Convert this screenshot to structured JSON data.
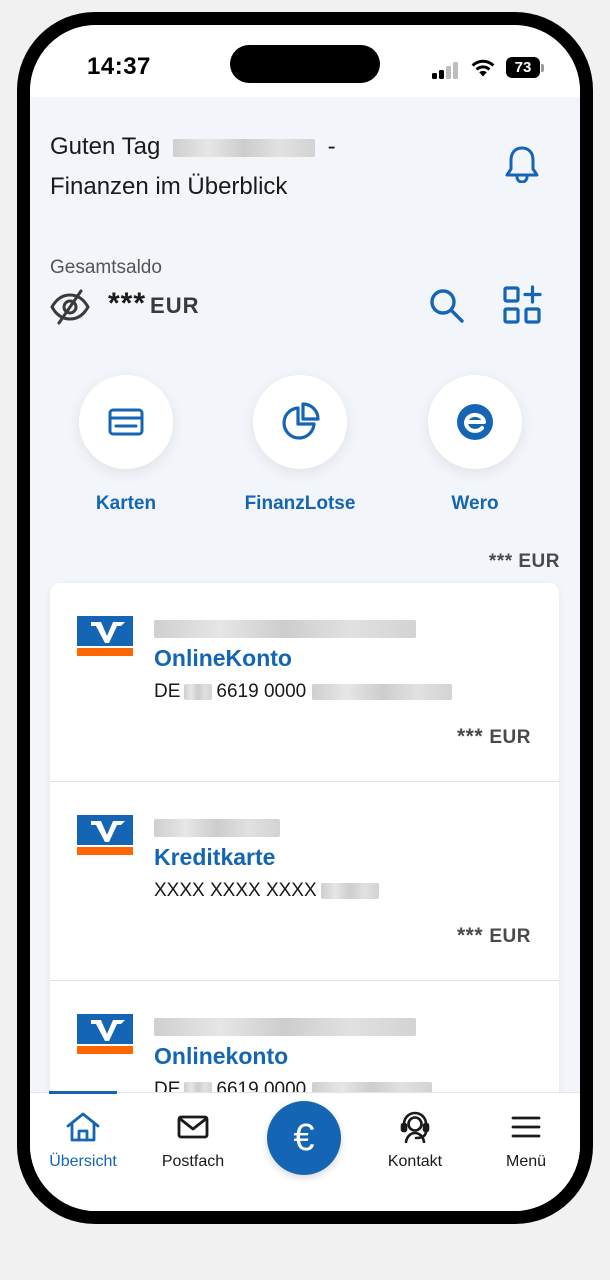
{
  "status": {
    "time": "14:37",
    "battery": "73",
    "icons": [
      "signal-icon",
      "wifi-icon",
      "battery-icon"
    ]
  },
  "header": {
    "greeting_prefix": "Guten Tag",
    "greeting_suffix": "-",
    "subtitle": "Finanzen im Überblick",
    "bell_icon": "bell-icon"
  },
  "saldo": {
    "label": "Gesamtsaldo",
    "value": "***",
    "currency": "EUR",
    "eye_icon": "eye-off-icon",
    "search_icon": "search-icon",
    "grid_icon": "grid-add-icon"
  },
  "quick_actions": [
    {
      "label": "Karten",
      "icon": "card-icon"
    },
    {
      "label": "FinanzLotse",
      "icon": "pie-chart-icon"
    },
    {
      "label": "Wero",
      "icon": "wero-icon"
    }
  ],
  "total": "*** EUR",
  "accounts": [
    {
      "name": "OnlineKonto",
      "iban_prefix": "DE",
      "iban_mid": "6619 0000",
      "balance": "***",
      "currency": "EUR"
    },
    {
      "name": "Kreditkarte",
      "iban_prefix": "XXXX XXXX XXXX",
      "iban_mid": "",
      "balance": "***",
      "currency": "EUR"
    },
    {
      "name": "Onlinekonto",
      "iban_prefix": "DE",
      "iban_mid": "6619 0000",
      "balance": "",
      "currency": ""
    }
  ],
  "nav": {
    "items": [
      {
        "label": "Übersicht",
        "icon": "home-icon"
      },
      {
        "label": "Postfach",
        "icon": "mail-icon"
      },
      {
        "label": "Kontakt",
        "icon": "headset-icon"
      },
      {
        "label": "Menü",
        "icon": "menu-icon"
      }
    ],
    "center_symbol": "€",
    "center_icon": "euro-icon"
  },
  "colors": {
    "brand_blue": "#1565b5",
    "brand_orange": "#ff6600",
    "background": "#f2f5f9"
  }
}
